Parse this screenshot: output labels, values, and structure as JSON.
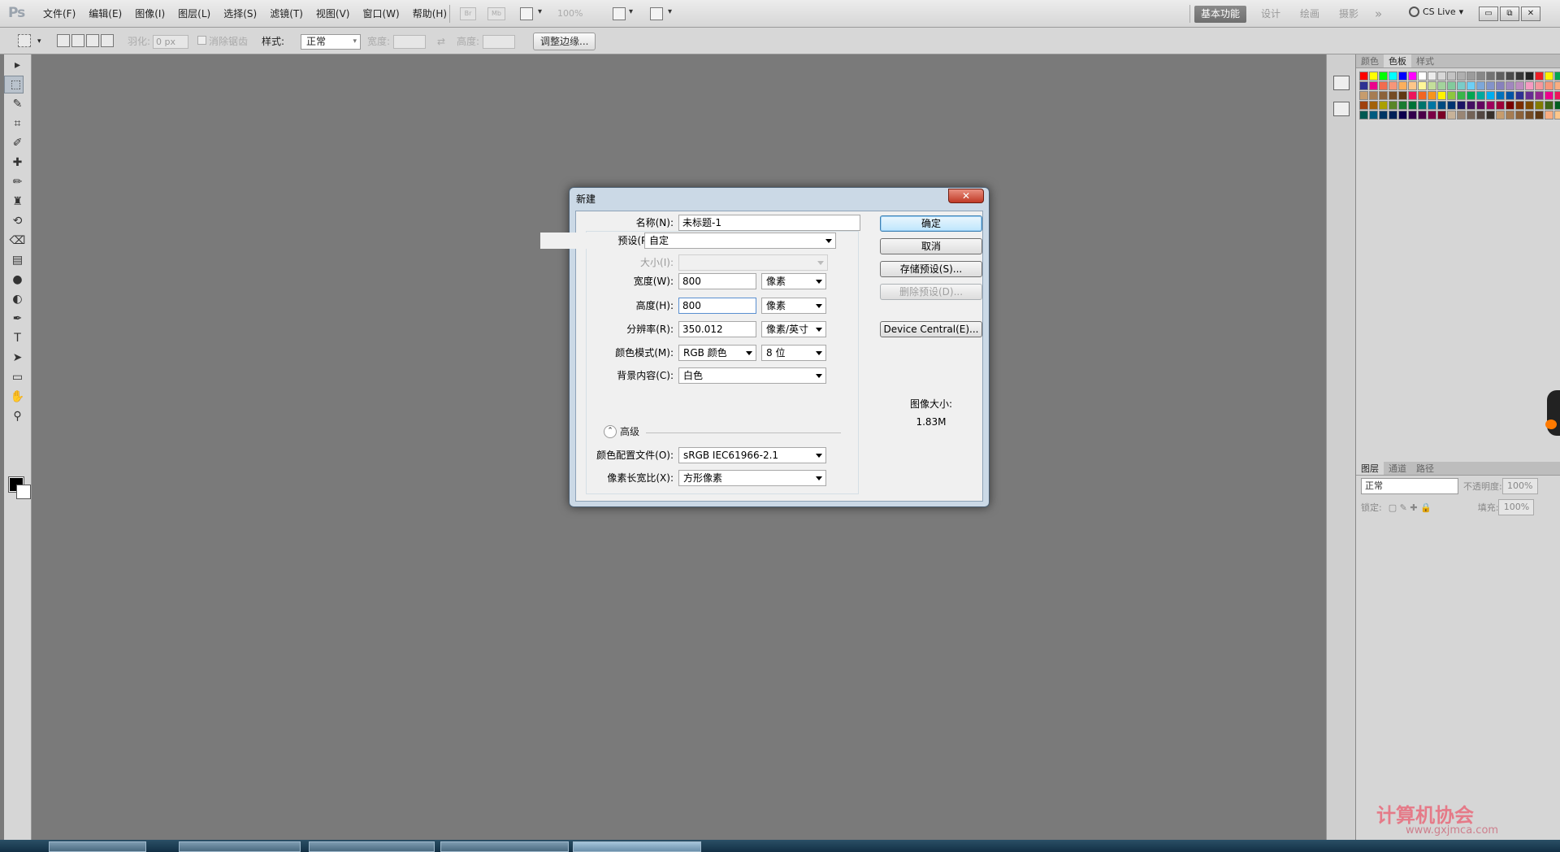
{
  "menubar": {
    "logo": "Ps",
    "items": [
      "文件(F)",
      "编辑(E)",
      "图像(I)",
      "图层(L)",
      "选择(S)",
      "滤镜(T)",
      "视图(V)",
      "窗口(W)",
      "帮助(H)"
    ],
    "bridge_label": "Br",
    "minibridge_label": "Mb",
    "zoom": "100%",
    "workspaces": [
      "基本功能",
      "设计",
      "绘画",
      "摄影"
    ],
    "more_label": "»",
    "cslive_label": "CS Live",
    "window_buttons": [
      "▭",
      "⧉",
      "✕"
    ]
  },
  "options": {
    "feather_label": "羽化:",
    "feather_value": "0 px",
    "antialias_label": "消除锯齿",
    "style_label": "样式:",
    "style_value": "正常",
    "width_label": "宽度:",
    "height_label": "高度:",
    "refine_button": "调整边缘..."
  },
  "tools": [
    "▸",
    "⬚",
    "ʘ",
    "✎",
    "⌗",
    "✐",
    "✚",
    "✏",
    "♜",
    "⟲",
    "⌫",
    "▤",
    "●",
    "◐",
    "✒",
    "T",
    "➤",
    "▭",
    "✋",
    "⚲"
  ],
  "panels": {
    "swatch_tabs": [
      "颜色",
      "色板",
      "样式"
    ],
    "active_swatch_tab": 1,
    "layer_tabs": [
      "图层",
      "通道",
      "路径"
    ],
    "blend_mode": "正常",
    "opacity_label": "不透明度:",
    "opacity_value": "100%",
    "lock_label": "锁定:",
    "fill_label": "填充:",
    "fill_value": "100%",
    "swatch_colors": [
      "#ff0000",
      "#ffff00",
      "#00ff00",
      "#00ffff",
      "#0000ff",
      "#ff00ff",
      "#ffffff",
      "#ebebeb",
      "#d7d7d7",
      "#c3c3c3",
      "#afafaf",
      "#9b9b9b",
      "#878787",
      "#737373",
      "#5f5f5f",
      "#4b4b4b",
      "#373737",
      "#232323",
      "#ed1c24",
      "#fff200",
      "#00a651",
      "#00aeef",
      "#2e3192",
      "#ec008c",
      "#f26c4f",
      "#f69679",
      "#fbaf5d",
      "#fdc689",
      "#fff799",
      "#c4df9b",
      "#a3d39c",
      "#82ca9c",
      "#7accc8",
      "#6dcff6",
      "#7da7d9",
      "#8393ca",
      "#8781bd",
      "#a187be",
      "#bd8cbf",
      "#f49ac1",
      "#f5989d",
      "#f7977a",
      "#f9ad81",
      "#fdc68a",
      "#c69c6d",
      "#a67c52",
      "#8c6239",
      "#754c24",
      "#603913",
      "#ed145b",
      "#f26522",
      "#f7941d",
      "#fff200",
      "#8dc63f",
      "#39b54a",
      "#00a651",
      "#00a99d",
      "#00aeef",
      "#0072bc",
      "#0054a6",
      "#2e3192",
      "#662d91",
      "#92278f",
      "#ec008c",
      "#ed145b",
      "#9e0b0f",
      "#a0410d",
      "#a36209",
      "#aba000",
      "#598527",
      "#197b30",
      "#007236",
      "#00746b",
      "#0076a3",
      "#004a80",
      "#003471",
      "#1b1464",
      "#440e62",
      "#630460",
      "#9e005d",
      "#9e0039",
      "#790000",
      "#7b2e00",
      "#7d4900",
      "#827b00",
      "#406618",
      "#005e20",
      "#005826",
      "#005952",
      "#005b7f",
      "#003663",
      "#002157",
      "#0d004c",
      "#32004b",
      "#4b0049",
      "#7b0046",
      "#7a0026",
      "#c7b299",
      "#998675",
      "#736357",
      "#534741",
      "#37302a",
      "#c69c6d",
      "#a67c52",
      "#8c6239",
      "#754c24",
      "#603913",
      "#f9ad81",
      "#fdc68a"
    ]
  },
  "dialog": {
    "title": "新建",
    "close": "✕",
    "name_label": "名称(N):",
    "name_value": "未标题-1",
    "preset_label": "预设(P):",
    "preset_value": "自定",
    "size_label": "大小(I):",
    "size_value": "",
    "width_label": "宽度(W):",
    "width_value": "800",
    "width_unit": "像素",
    "height_label": "高度(H):",
    "height_value": "800",
    "height_unit": "像素",
    "resolution_label": "分辨率(R):",
    "resolution_value": "350.012",
    "resolution_unit": "像素/英寸",
    "colormode_label": "颜色模式(M):",
    "colormode_value": "RGB 颜色",
    "bitdepth_value": "8 位",
    "background_label": "背景内容(C):",
    "background_value": "白色",
    "advanced_label": "高级",
    "profile_label": "颜色配置文件(O):",
    "profile_value": "sRGB IEC61966-2.1",
    "aspect_label": "像素长宽比(X):",
    "aspect_value": "方形像素",
    "ok_button": "确定",
    "cancel_button": "取消",
    "save_preset_button": "存储预设(S)...",
    "delete_preset_button": "删除预设(D)...",
    "device_central_button": "Device Central(E)...",
    "image_size_label": "图像大小:",
    "image_size_value": "1.83M"
  },
  "watermark": {
    "line1": "计算机协会",
    "line2": "www.gxjmca.com"
  }
}
